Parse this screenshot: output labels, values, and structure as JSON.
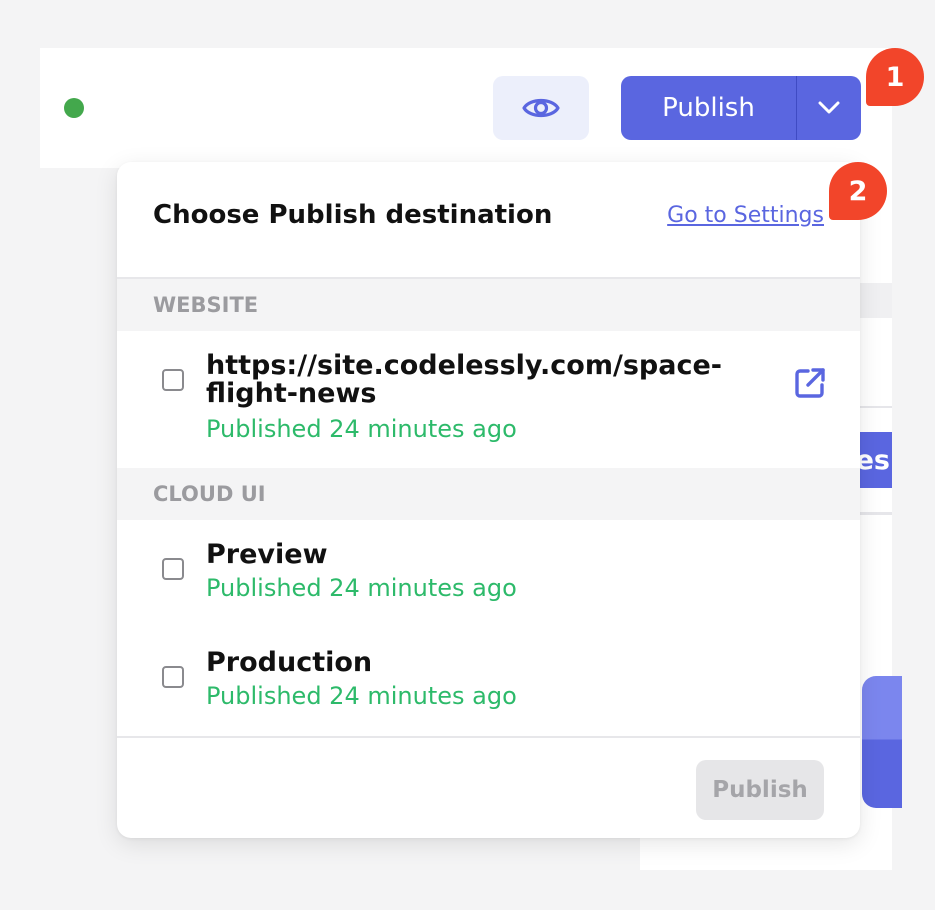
{
  "topbar": {
    "status": "online",
    "publish_label": "Publish",
    "icons": {
      "preview": "eye-icon",
      "dropdown": "chevron-down-icon"
    }
  },
  "badges": [
    "1",
    "2"
  ],
  "background_panel": {
    "pill_text": "es"
  },
  "dropdown": {
    "title": "Choose Publish destination",
    "settings_link": "Go to Settings",
    "sections": [
      {
        "label": "WEBSITE",
        "items": [
          {
            "title_line1": "https://site.codelessly.com/space-",
            "title_line2": "flight-news",
            "status": "Published 24 minutes ago",
            "icon": "external-link-icon"
          }
        ]
      },
      {
        "label": "CLOUD UI",
        "items": [
          {
            "title": "Preview",
            "status": "Published 24 minutes ago"
          },
          {
            "title": "Production",
            "status": "Published 24 minutes ago"
          }
        ]
      }
    ],
    "footer_button": "Publish"
  },
  "colors": {
    "accent": "#5a66e0",
    "success": "#2dba6a",
    "badge": "#f2452a",
    "status_dot": "#43a84c"
  }
}
